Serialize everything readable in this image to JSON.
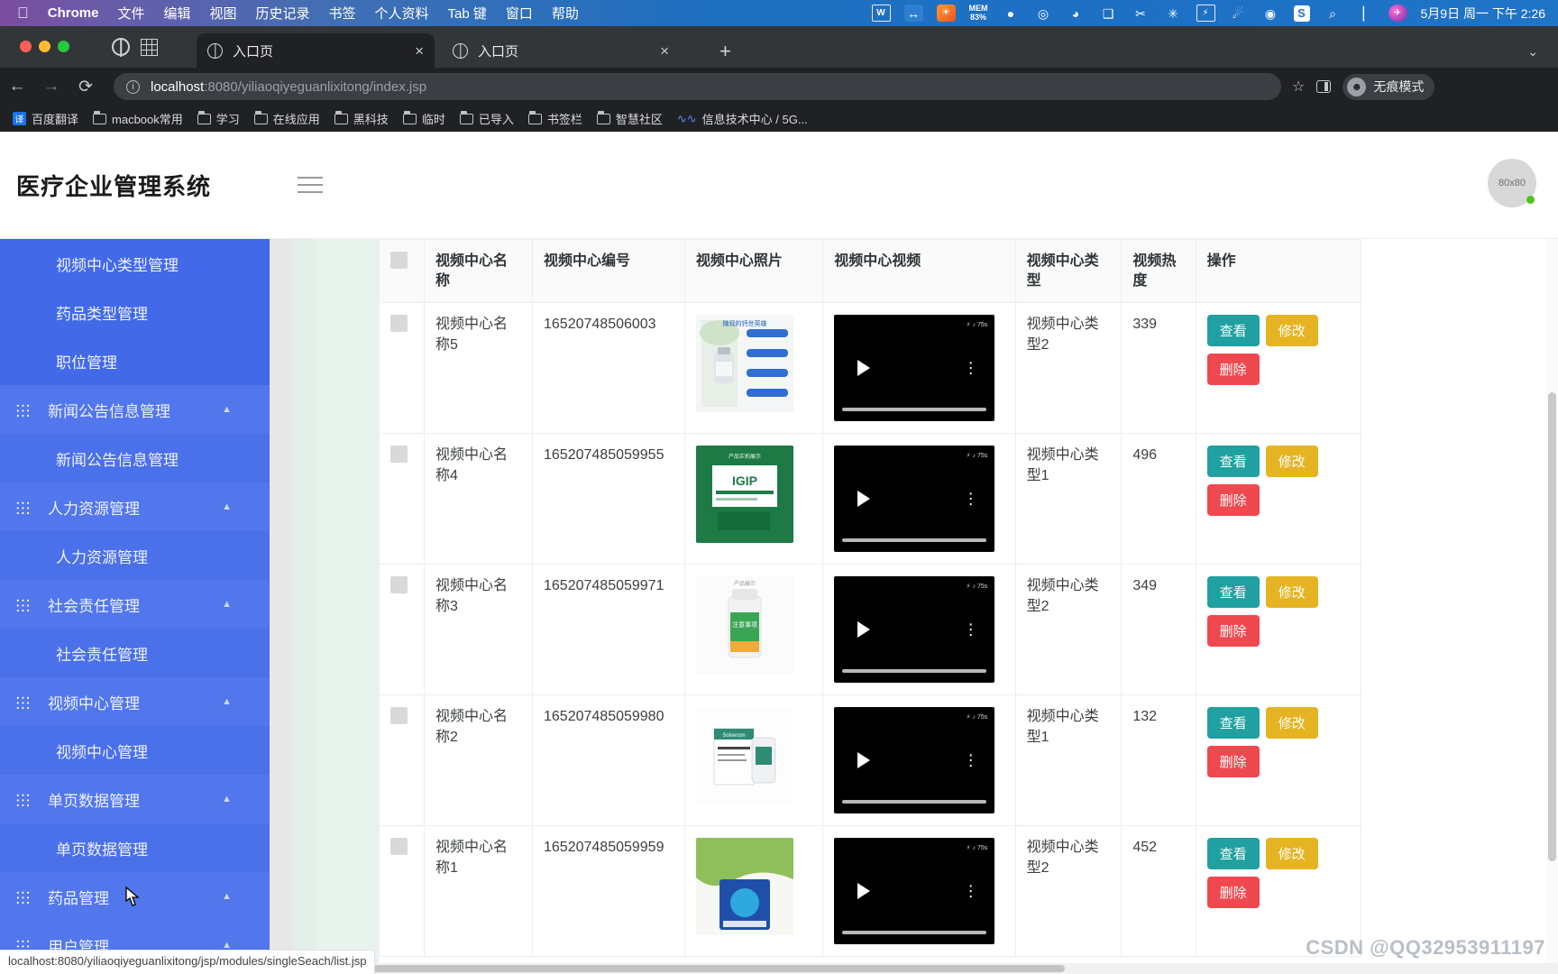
{
  "menubar": {
    "apple": "",
    "app": "Chrome",
    "items": [
      "文件",
      "编辑",
      "视图",
      "历史记录",
      "书签",
      "个人资料",
      "Tab 键",
      "窗口",
      "帮助"
    ],
    "tray": [
      {
        "name": "wps-icon",
        "glyph": "W"
      },
      {
        "name": "bluetooth-transfer-icon",
        "glyph": "↔"
      },
      {
        "name": "app-orange-icon",
        "glyph": "☀"
      },
      {
        "name": "memory-monitor",
        "glyph": "MEM",
        "value": "83%"
      },
      {
        "name": "bartender-icon",
        "glyph": "⬤"
      },
      {
        "name": "power-icon",
        "glyph": "◎"
      },
      {
        "name": "clock-widget-icon",
        "glyph": "◔"
      },
      {
        "name": "window-manager-icon",
        "glyph": "❐"
      },
      {
        "name": "scissors-icon",
        "glyph": "✂"
      },
      {
        "name": "bluetooth-icon",
        "glyph": "✳"
      },
      {
        "name": "battery-icon",
        "glyph": "⚡"
      },
      {
        "name": "wifi-icon",
        "glyph": "✦"
      },
      {
        "name": "control-center-icon",
        "glyph": "◉"
      },
      {
        "name": "sogou-input-icon",
        "glyph": "S"
      },
      {
        "name": "spotlight-search-icon",
        "glyph": "⌕"
      },
      {
        "name": "control-toggle-icon",
        "glyph": "⊜"
      },
      {
        "name": "siri-icon",
        "glyph": "✈"
      }
    ],
    "clock": "5月9日 周一 下午 2:26"
  },
  "browser": {
    "tabs": [
      {
        "title": "入口页",
        "active": true
      },
      {
        "title": "入口页",
        "active": false
      }
    ],
    "new_tab_label": "+",
    "tablist_chevron": "⌄",
    "nav": {
      "back": "←",
      "forward": "→",
      "reload": "⟳"
    },
    "omnibox": {
      "info": "ⓘ",
      "host": "localhost",
      "path": ":8080/yiliaoqiyeguanlixitong/index.jsp"
    },
    "star": "☆",
    "profile": {
      "label": "无痕模式",
      "avatar_glyph": "☻"
    },
    "bookmarks": [
      {
        "label": "百度翻译",
        "icon": "translate-icon"
      },
      {
        "label": "macbook常用",
        "icon": "folder-icon"
      },
      {
        "label": "学习",
        "icon": "folder-icon"
      },
      {
        "label": "在线应用",
        "icon": "folder-icon"
      },
      {
        "label": "黑科技",
        "icon": "folder-icon"
      },
      {
        "label": "临时",
        "icon": "folder-icon"
      },
      {
        "label": "已导入",
        "icon": "folder-icon"
      },
      {
        "label": "书签栏",
        "icon": "folder-icon"
      },
      {
        "label": "智慧社区",
        "icon": "folder-icon"
      },
      {
        "label": "信息技术中心 / 5G...",
        "icon": "wave-icon"
      }
    ]
  },
  "app": {
    "title": "医疗企业管理系统",
    "avatar_label": "80x80",
    "menu": [
      {
        "label": "视频中心类型管理",
        "type": "child",
        "highlight": false
      },
      {
        "label": "药品类型管理",
        "type": "child",
        "highlight": false
      },
      {
        "label": "职位管理",
        "type": "child",
        "highlight": false
      },
      {
        "label": "新闻公告信息管理",
        "type": "parent",
        "caret": "▲"
      },
      {
        "label": "新闻公告信息管理",
        "type": "child",
        "highlight": true
      },
      {
        "label": "人力资源管理",
        "type": "parent",
        "caret": "▲"
      },
      {
        "label": "人力资源管理",
        "type": "child",
        "highlight": true
      },
      {
        "label": "社会责任管理",
        "type": "parent",
        "caret": "▲"
      },
      {
        "label": "社会责任管理",
        "type": "child",
        "highlight": true
      },
      {
        "label": "视频中心管理",
        "type": "parent",
        "caret": "▲"
      },
      {
        "label": "视频中心管理",
        "type": "child",
        "highlight": true
      },
      {
        "label": "单页数据管理",
        "type": "parent",
        "caret": "▲"
      },
      {
        "label": "单页数据管理",
        "type": "child",
        "highlight": true
      },
      {
        "label": "药品管理",
        "type": "parent",
        "caret": "▲"
      },
      {
        "label": "用户管理",
        "type": "parent",
        "caret": "▲"
      }
    ]
  },
  "table": {
    "columns": [
      "",
      "视频中心名称",
      "视频中心编号",
      "视频中心照片",
      "视频中心视频",
      "视频中心类型",
      "视频热度",
      "操作"
    ],
    "actions": {
      "view": "查看",
      "edit": "修改",
      "delete": "删除"
    },
    "rows": [
      {
        "name": "视频中心名称5",
        "code": "16520748506003",
        "type": "视频中心类型2",
        "hot": "339",
        "photo_caption": "微观的钙世英雄"
      },
      {
        "name": "视频中心名称4",
        "code": "165207485059955",
        "type": "视频中心类型1",
        "hot": "496",
        "photo_caption": "产品实拍展示"
      },
      {
        "name": "视频中心名称3",
        "code": "165207485059971",
        "type": "视频中心类型2",
        "hot": "349",
        "photo_caption": "产品展示"
      },
      {
        "name": "视频中心名称2",
        "code": "165207485059980",
        "type": "视频中心类型1",
        "hot": "132",
        "photo_caption": "Solverom prostate"
      },
      {
        "name": "视频中心名称1",
        "code": "165207485059959",
        "type": "视频中心类型2",
        "hot": "452",
        "photo_caption": ""
      }
    ]
  },
  "status_bar": "localhost:8080/yiliaoqiyeguanlixitong/jsp/modules/singleSeach/list.jsp",
  "watermark": "CSDN @QQ32953911197"
}
